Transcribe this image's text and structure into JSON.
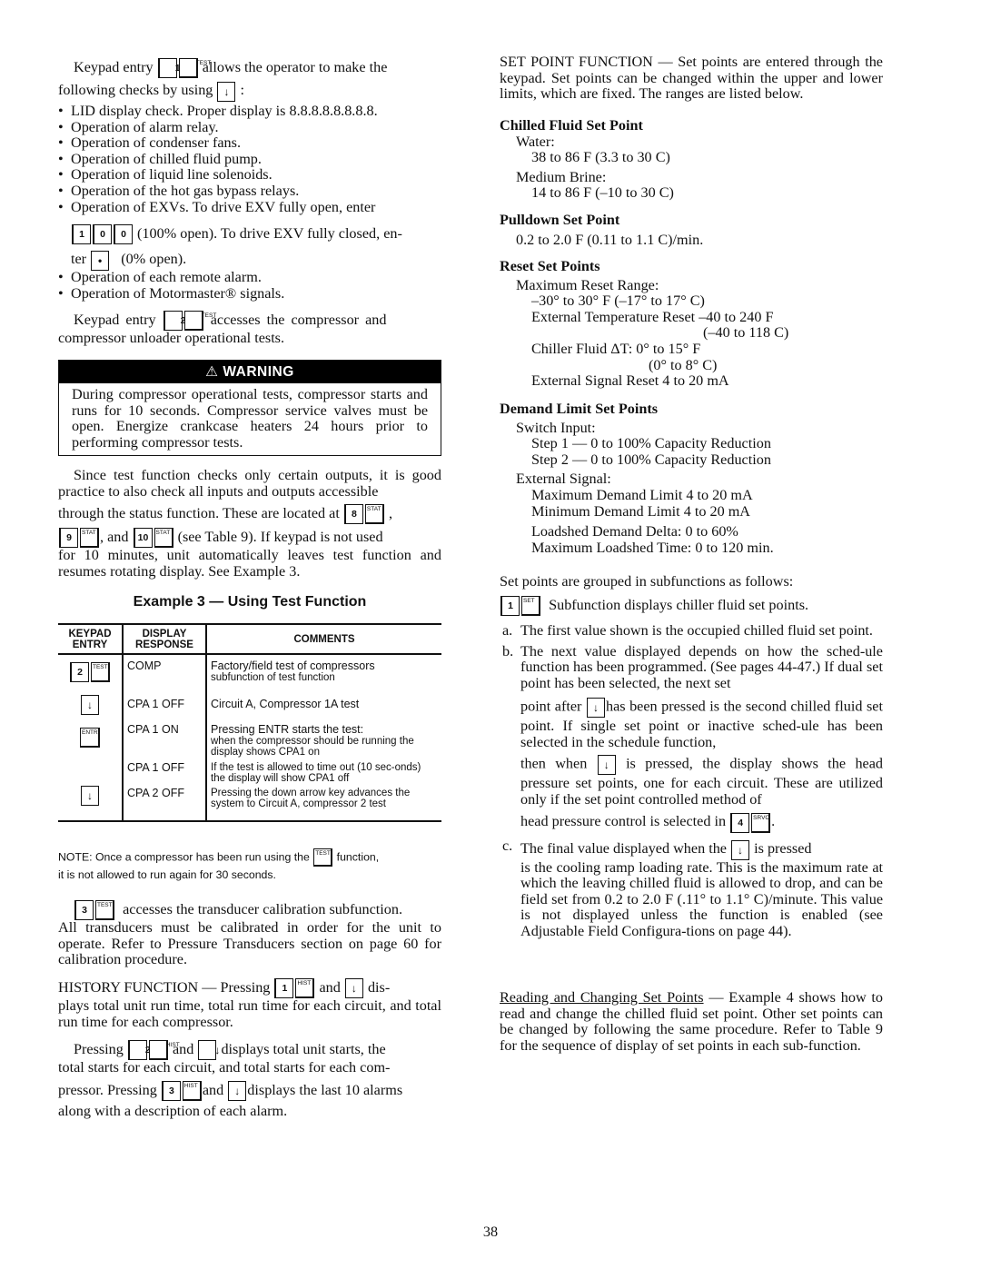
{
  "page_number": "38",
  "keys": {
    "k1": "1",
    "k2": "2",
    "k3": "3",
    "k4": "4",
    "k8": "8",
    "k9": "9",
    "k10": "10",
    "k0": "0",
    "dot": "•",
    "test": "TEST",
    "stat": "STAT",
    "hist": "HIST",
    "set": "SET",
    "srvc": "SRVC",
    "entr": "ENTR",
    "down": "↓"
  },
  "left": {
    "p1_a": "Keypad entry",
    "p1_b": "allows the operator to make the",
    "p1_c": "following checks by using",
    "p1_d": ":",
    "bullets": [
      "LID display check. Proper display is 8.8.8.8.8.8.8.8.",
      "Operation of alarm relay.",
      "Operation of condenser fans.",
      "Operation of chilled fluid pump.",
      "Operation of liquid line solenoids.",
      "Operation of the hot gas bypass relays.",
      "Operation of EXVs. To drive EXV fully open, enter"
    ],
    "exv_a": "(100% open). To drive EXV fully closed, en-",
    "exv_b": "ter",
    "exv_c": "(0% open).",
    "bullets2": [
      "Operation of each remote alarm.",
      "Operation of Motormaster® signals."
    ],
    "p2_a": "Keypad entry",
    "p2_b": "accesses the compressor and",
    "p2_c": "compressor unloader operational tests.",
    "warning": {
      "title": "WARNING",
      "icon": "⚠",
      "body": "During compressor operational tests, compressor starts and runs for 10 seconds. Compressor service valves must be open. Energize crankcase heaters 24 hours prior to performing compressor tests."
    },
    "p3_a": "Since test function checks only certain outputs, it is good practice to also check all inputs and outputs accessible",
    "p3_b": "through the status function. These are located at",
    "p3_c": ",",
    "p3_d": ", and",
    "p3_e": "(see Table 9). If keypad is not used",
    "p3_f": "for 10 minutes, unit automatically leaves test function and resumes rotating display. See Example 3.",
    "example_title": "Example 3 — Using Test Function",
    "table": {
      "headers": [
        "KEYPAD ENTRY",
        "DISPLAY RESPONSE",
        "COMMENTS"
      ],
      "rows": [
        {
          "keys": [
            "2",
            "TEST"
          ],
          "display": "COMP",
          "comment": "Factory/field test of compressors",
          "comment2": "subfunction of test function"
        },
        {
          "keys": [
            "↓"
          ],
          "display": "CPA 1 OFF",
          "comment": "Circuit A, Compressor 1A test",
          "comment2": ""
        },
        {
          "keys": [
            "ENTR"
          ],
          "display": "CPA 1 ON",
          "comment": "Pressing ENTR starts the test:",
          "comment2": "when the compressor should be running the display shows CPA1 on"
        },
        {
          "keys": [],
          "display": "CPA 1 OFF",
          "comment": "",
          "comment2": "If the test is allowed to time out (10 sec-onds) the display will show CPA1 off"
        },
        {
          "keys": [
            "↓"
          ],
          "display": "CPA 2 OFF",
          "comment": "",
          "comment2": "Pressing the down arrow key advances the system to Circuit A, compressor 2 test"
        }
      ]
    },
    "note_a": "NOTE: Once a compressor has been run using the",
    "note_b": "function,",
    "note_c": "it is not allowed to run again for 30 seconds.",
    "p4_a": "accesses the transducer calibration subfunction.",
    "p4_b": "All transducers must be calibrated in order for the unit to operate. Refer to Pressure Transducers section on page 60 for calibration procedure.",
    "p5_a": "HISTORY FUNCTION — Pressing",
    "p5_b": "and",
    "p5_c": "dis-",
    "p5_d": "plays total unit run time, total run time for each circuit, and total run time for each compressor.",
    "p6_a": "Pressing",
    "p6_b": "and",
    "p6_c": "displays total unit starts, the",
    "p6_d": "total starts for each circuit, and total starts for each com-",
    "p6_e": "pressor. Pressing",
    "p6_f": "and",
    "p6_g": "displays the last 10 alarms",
    "p6_h": "along with a description of each alarm."
  },
  "right": {
    "intro": "SET POINT FUNCTION — Set points are entered through the keypad. Set points can be changed within the upper and lower limits, which are fixed. The ranges are listed below.",
    "chilled": {
      "heading": "Chilled Fluid Set Point",
      "water_label": "Water:",
      "water_range": "38 to 86 F (3.3 to 30 C)",
      "brine_label": "Medium Brine:",
      "brine_range": "14 to 86 F (–10 to 30 C)"
    },
    "pulldown": {
      "heading": "Pulldown Set Point",
      "range": "0.2 to 2.0 F (0.11 to 1.1 C)/min."
    },
    "reset": {
      "heading": "Reset Set Points",
      "max_label": "Maximum Reset Range:",
      "max_range": "–30° to 30° F (–17° to 17° C)",
      "ext_temp": "External Temperature Reset –40 to 240 F",
      "ext_temp_c": "(–40 to 118 C)",
      "fluid_dt": "Chiller Fluid ΔT: 0° to 15° F",
      "fluid_dt_c": "(0° to 8° C)",
      "ext_signal": "External Signal Reset 4 to 20 mA"
    },
    "demand": {
      "heading": "Demand Limit Set Points",
      "switch_label": "Switch Input:",
      "step1": "Step 1 — 0 to 100% Capacity Reduction",
      "step2": "Step 2 — 0 to 100% Capacity Reduction",
      "ext_label": "External Signal:",
      "max": "Maximum Demand Limit 4 to 20 mA",
      "min": "Minimum Demand Limit 4 to 20 mA",
      "delta": "Loadshed Demand Delta: 0 to 60%",
      "time": "Maximum Loadshed Time: 0 to 120 min."
    },
    "grouped": "Set points are grouped in subfunctions as follows:",
    "subfn": "Subfunction displays chiller fluid set points.",
    "item_a_label": "a.",
    "item_a": "The first value shown is the occupied chilled fluid set point.",
    "item_b_label": "b.",
    "item_b1": "The next value displayed depends on how the sched-ule function has been programmed. (See pages 44-47.) If dual set point has been selected, the next set",
    "item_b2_a": "point after",
    "item_b2_b": "has been pressed is the second chilled fluid set point. If single set point or inactive sched-ule has been selected in the schedule function,",
    "item_b3_a": "then when",
    "item_b3_b": "is pressed, the display shows the head pressure set points, one for each circuit. These are utilized only if the set point controlled method of",
    "item_b4_a": "head pressure control is selected in",
    "item_b4_b": ".",
    "item_c_label": "c.",
    "item_c_a": "The final value displayed when the",
    "item_c_b": "is pressed",
    "item_c_c": "is the cooling ramp loading rate. This is the maximum rate at which the leaving chilled fluid is allowed to drop, and can be field set from 0.2 to 2.0 F (.11° to 1.1° C)/minute. This value is not displayed unless the function is enabled (see Adjustable Field Configura-tions on page 44).",
    "reading_link": "Reading and Changing Set Points",
    "reading_text": " — Example 4 shows how to read and change the chilled fluid set point. Other set points can be changed by following the same procedure. Refer to Table 9 for the sequence of display of set points in each sub-function."
  }
}
